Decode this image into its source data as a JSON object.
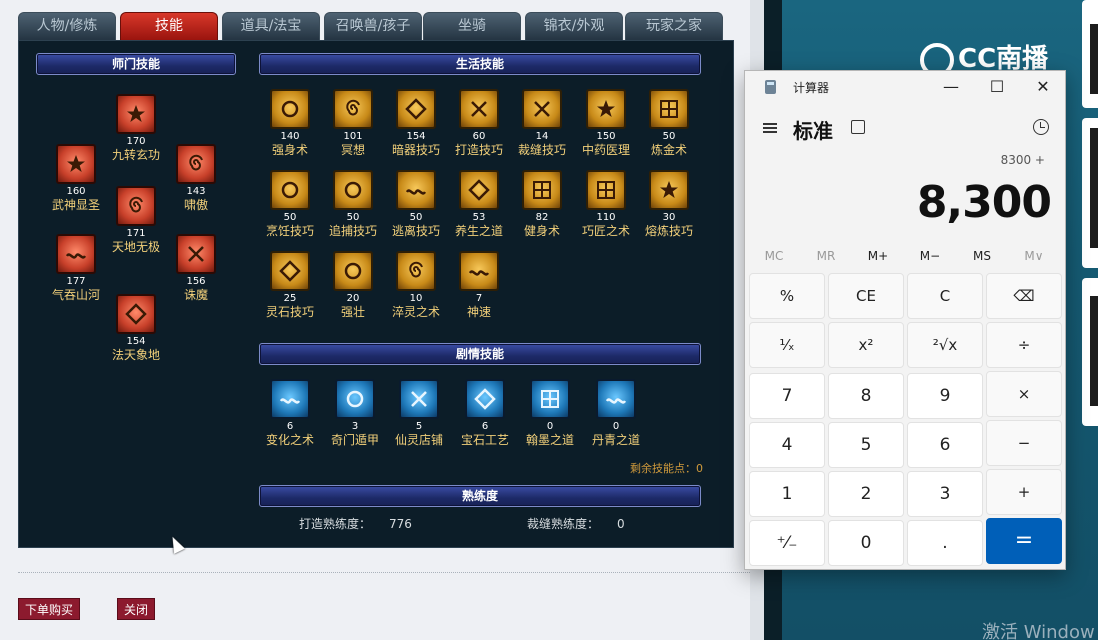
{
  "tabs": [
    {
      "label": "人物/修炼",
      "active": false
    },
    {
      "label": "技能",
      "active": true
    },
    {
      "label": "道具/法宝",
      "active": false
    },
    {
      "label": "召唤兽/孩子",
      "active": false
    },
    {
      "label": "坐骑",
      "active": false
    },
    {
      "label": "锦衣/外观",
      "active": false
    },
    {
      "label": "玩家之家",
      "active": false
    }
  ],
  "sections": {
    "master": "师门技能",
    "life": "生活技能",
    "story": "剧情技能",
    "proficiency": "熟练度"
  },
  "master_skills": [
    {
      "name": "九转玄功",
      "level": "170",
      "icon": "flame-icon"
    },
    {
      "name": "武神显圣",
      "level": "160",
      "icon": "burst-icon"
    },
    {
      "name": "啸傲",
      "level": "143",
      "icon": "dragon-icon"
    },
    {
      "name": "天地无极",
      "level": "171",
      "icon": "vortex-icon"
    },
    {
      "name": "气吞山河",
      "level": "177",
      "icon": "mountain-icon"
    },
    {
      "name": "诛魔",
      "level": "156",
      "icon": "claw-icon"
    },
    {
      "name": "法天象地",
      "level": "154",
      "icon": "horn-icon"
    }
  ],
  "life_skills": [
    {
      "name": "强身术",
      "level": "140",
      "icon": "body-icon"
    },
    {
      "name": "冥想",
      "level": "101",
      "icon": "meditate-icon"
    },
    {
      "name": "暗器技巧",
      "level": "154",
      "icon": "dart-icon"
    },
    {
      "name": "打造技巧",
      "level": "60",
      "icon": "hammer-icon"
    },
    {
      "name": "裁缝技巧",
      "level": "14",
      "icon": "scissors-icon"
    },
    {
      "name": "中药医理",
      "level": "150",
      "icon": "herb-icon"
    },
    {
      "name": "炼金术",
      "level": "50",
      "icon": "alchemy-icon"
    },
    {
      "name": "烹饪技巧",
      "level": "50",
      "icon": "cook-icon"
    },
    {
      "name": "追捕技巧",
      "level": "50",
      "icon": "chain-icon"
    },
    {
      "name": "逃离技巧",
      "level": "50",
      "icon": "escape-icon"
    },
    {
      "name": "养生之道",
      "level": "53",
      "icon": "vitality-icon"
    },
    {
      "name": "健身术",
      "level": "82",
      "icon": "fitness-icon"
    },
    {
      "name": "巧匠之术",
      "level": "110",
      "icon": "craft-icon"
    },
    {
      "name": "熔炼技巧",
      "level": "30",
      "icon": "smelt-icon"
    },
    {
      "name": "灵石技巧",
      "level": "25",
      "icon": "gem-icon"
    },
    {
      "name": "强壮",
      "level": "20",
      "icon": "strong-icon"
    },
    {
      "name": "淬灵之术",
      "level": "10",
      "icon": "temper-icon"
    },
    {
      "name": "神速",
      "level": "7",
      "icon": "speed-icon"
    }
  ],
  "story_skills": [
    {
      "name": "变化之术",
      "level": "6",
      "icon": "transform-icon"
    },
    {
      "name": "奇门遁甲",
      "level": "3",
      "icon": "bagua-icon"
    },
    {
      "name": "仙灵店铺",
      "level": "5",
      "icon": "shop-icon"
    },
    {
      "name": "宝石工艺",
      "level": "6",
      "icon": "gem-craft-icon"
    },
    {
      "name": "翰墨之道",
      "level": "0",
      "icon": "ink-icon"
    },
    {
      "name": "丹青之道",
      "level": "0",
      "icon": "painting-icon"
    }
  ],
  "remaining_points": "剩余技能点：0",
  "proficiency": [
    {
      "label": "打造熟练度：",
      "value": "776"
    },
    {
      "label": "裁缝熟练度：",
      "value": "0"
    }
  ],
  "buttons": {
    "buy": "下单购买",
    "close": "关闭"
  },
  "watermark": "激活 Window",
  "logo": "CC南播",
  "calculator": {
    "title": "计算器",
    "mode": "标准",
    "expression": "8300 +",
    "display": "8,300",
    "memory": [
      {
        "label": "MC",
        "enabled": false
      },
      {
        "label": "MR",
        "enabled": false
      },
      {
        "label": "M+",
        "enabled": true
      },
      {
        "label": "M−",
        "enabled": true
      },
      {
        "label": "MS",
        "enabled": true
      },
      {
        "label": "M∨",
        "enabled": false
      }
    ],
    "keys": [
      [
        "%",
        "CE",
        "C",
        "⌫"
      ],
      [
        "¹⁄ₓ",
        "x²",
        "²√x",
        "÷"
      ],
      [
        "7",
        "8",
        "9",
        "×"
      ],
      [
        "4",
        "5",
        "6",
        "−"
      ],
      [
        "1",
        "2",
        "3",
        "+"
      ],
      [
        "⁺⁄₋",
        "0",
        ".",
        "="
      ]
    ],
    "window_controls": {
      "minimize": "—",
      "maximize": "☐",
      "close": "✕"
    }
  }
}
